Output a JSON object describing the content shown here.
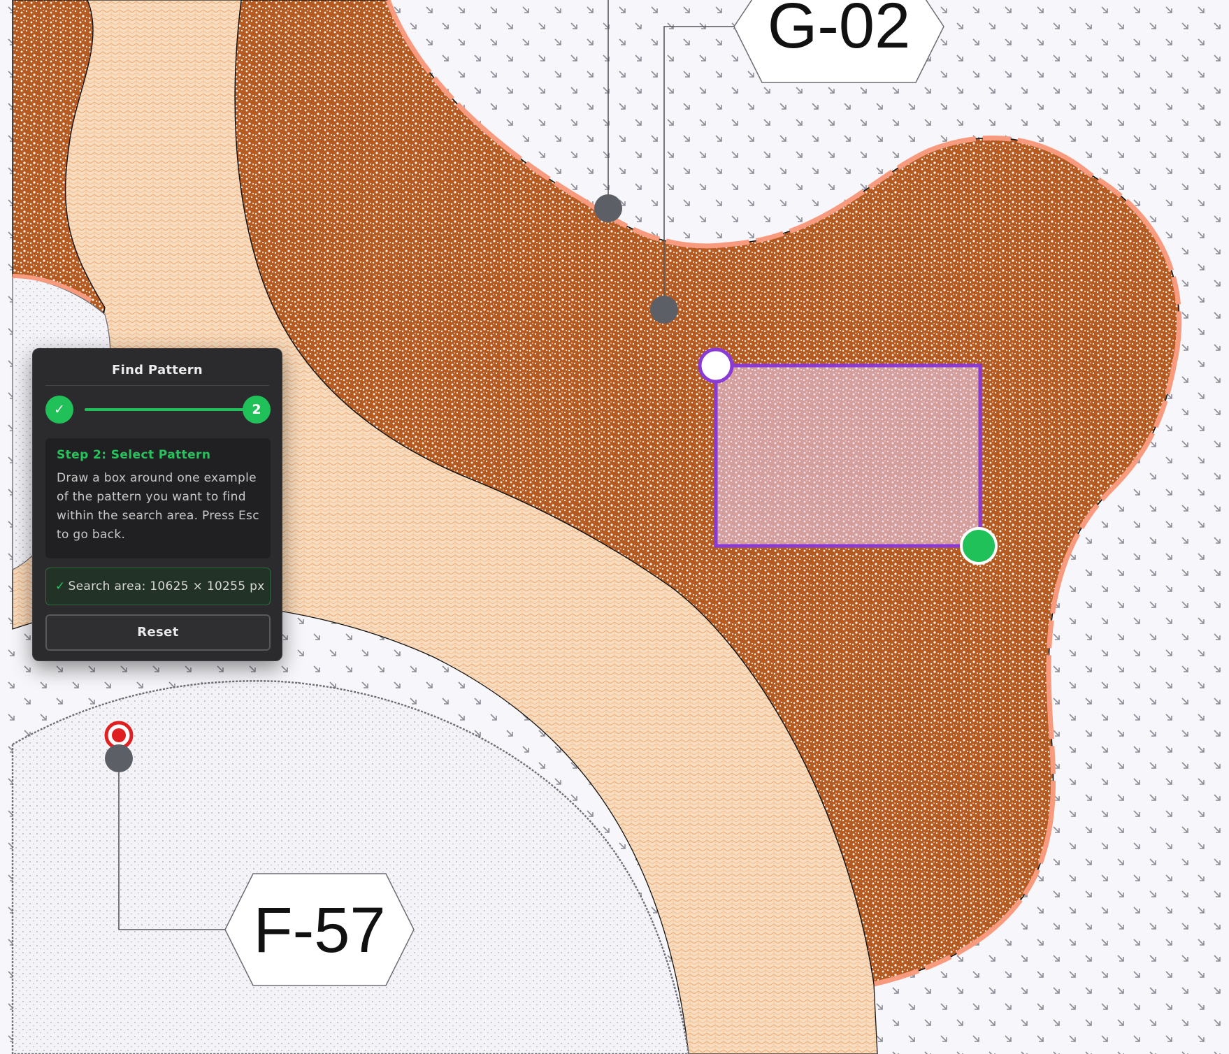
{
  "canvas": {
    "labels": [
      {
        "id": "g02",
        "text": "G-02"
      },
      {
        "id": "f57",
        "text": "F-57"
      }
    ],
    "colors": {
      "background": "#f7f7fb",
      "dense_region": "#b35a21",
      "band": "#f6dcc0",
      "boundary": "#f79a7e",
      "selection": "#8a3bd6",
      "handle_green": "#21c15a",
      "marker_red": "#e02020",
      "anchor": "#5d5f66"
    }
  },
  "panel": {
    "title": "Find Pattern",
    "steps": [
      {
        "state": "complete",
        "icon": "check-icon",
        "label": "✓"
      },
      {
        "state": "active",
        "label": "2"
      }
    ],
    "step_title": "Step 2: Select Pattern",
    "step_description": "Draw a box around one example of the pattern you want to find within the search area. Press Esc to go back.",
    "search_area_check": "✓",
    "search_area": "Search area: 10625 × 10255 px",
    "reset_label": "Reset"
  }
}
